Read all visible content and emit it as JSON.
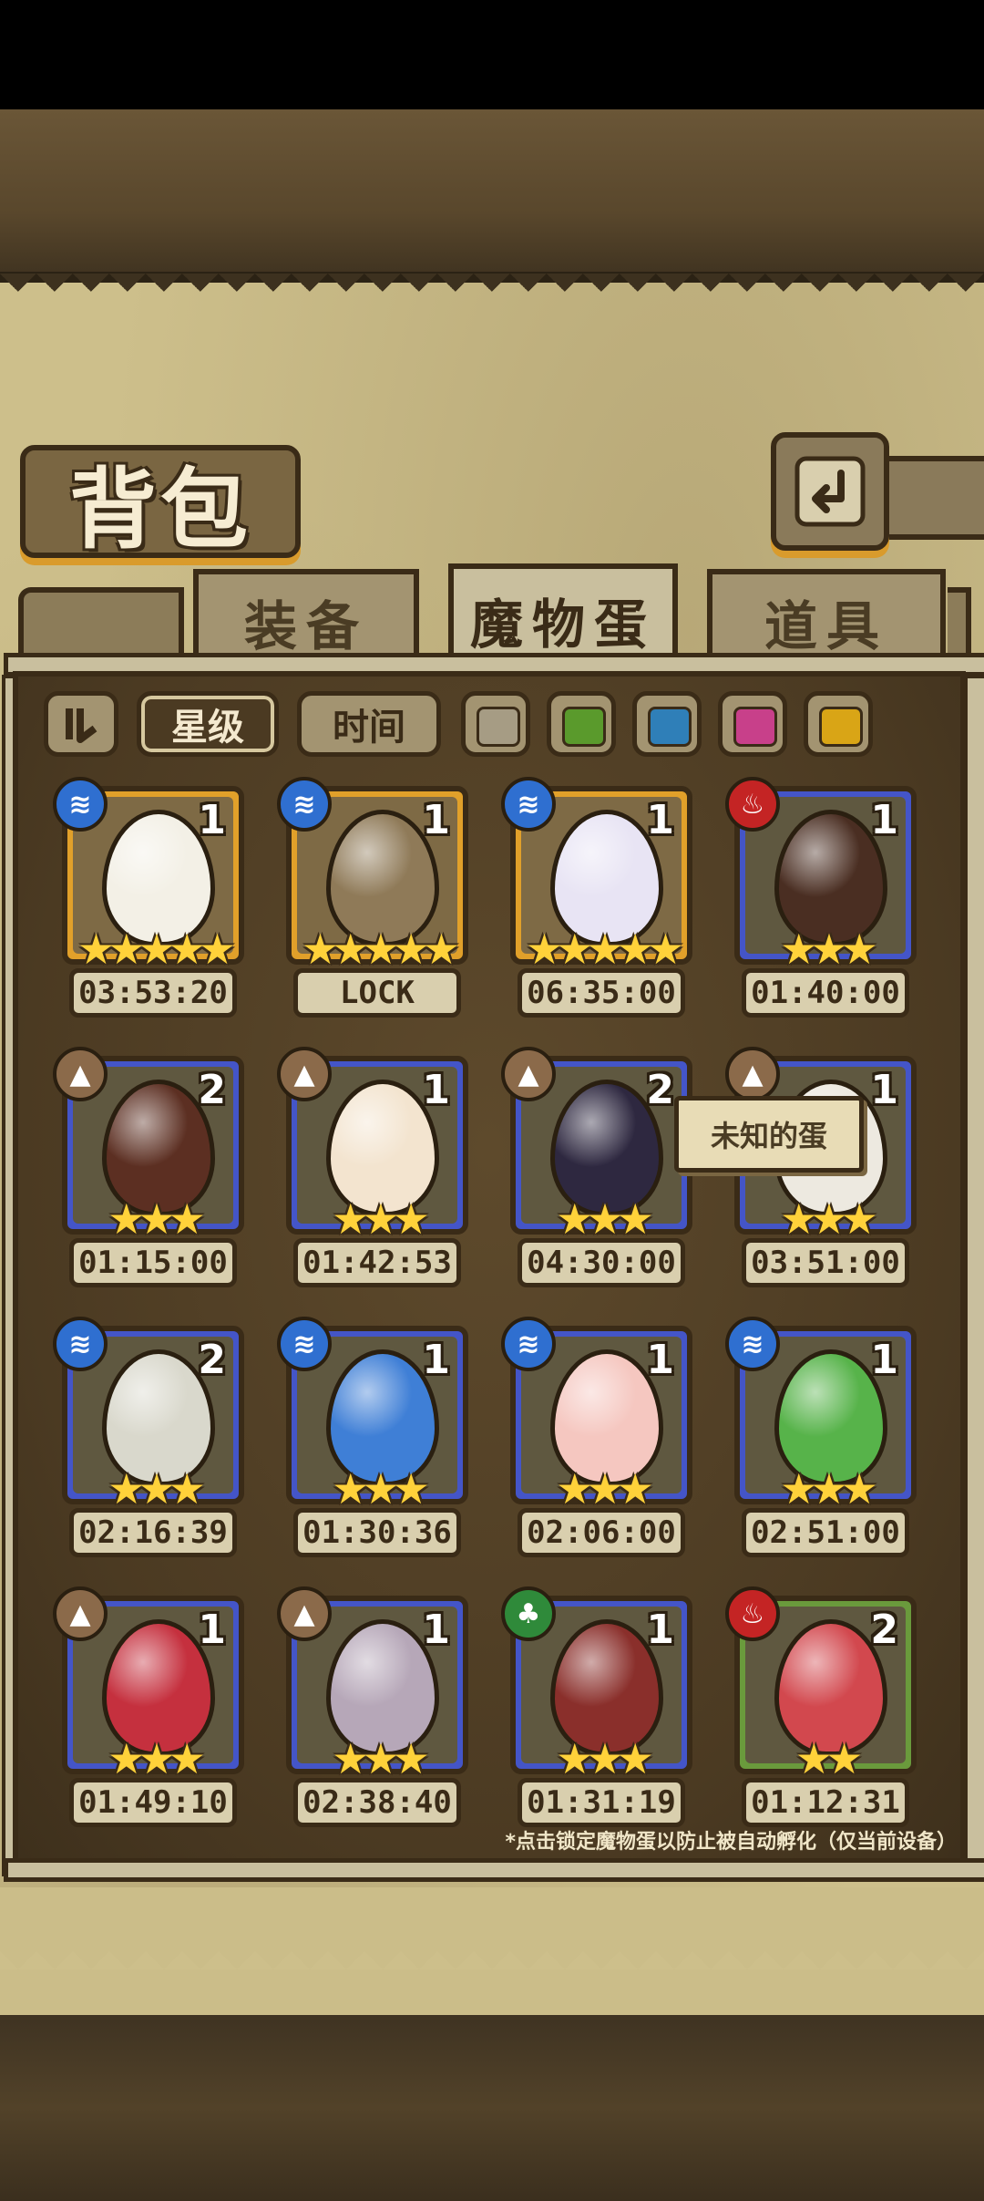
{
  "header": {
    "title": "背包",
    "back_icon": "back-arrow-icon"
  },
  "tabs": [
    {
      "label": "装备",
      "active": false
    },
    {
      "label": "魔物蛋",
      "active": true
    },
    {
      "label": "道具",
      "active": false
    }
  ],
  "filters": {
    "sort_icon": "sort-toggle-icon",
    "star_label": "星级",
    "time_label": "时间",
    "swatches": [
      {
        "name": "gray",
        "color": "#a69c84"
      },
      {
        "name": "green",
        "color": "#5a9a2c"
      },
      {
        "name": "blue",
        "color": "#2f7fb8"
      },
      {
        "name": "pink",
        "color": "#c8408a"
      },
      {
        "name": "yellow",
        "color": "#d9a516"
      }
    ]
  },
  "eggs": [
    {
      "element": "water",
      "count": "1",
      "stars": "★★★★★",
      "time": "03:53:20",
      "frame": "gold",
      "color": "#f3f0e6"
    },
    {
      "element": "water",
      "count": "1",
      "stars": "★★★★★",
      "time": "LOCK",
      "frame": "gold",
      "color": "#8f7a58"
    },
    {
      "element": "water",
      "count": "1",
      "stars": "★★★★★",
      "time": "06:35:00",
      "frame": "gold",
      "color": "#e8e4f4"
    },
    {
      "element": "fire",
      "count": "1",
      "stars": "★★★",
      "time": "01:40:00",
      "frame": "blue",
      "color": "#4a2e22"
    },
    {
      "element": "earth",
      "count": "2",
      "stars": "★★★",
      "time": "01:15:00",
      "frame": "blue",
      "color": "#5c2f22"
    },
    {
      "element": "earth",
      "count": "1",
      "stars": "★★★",
      "time": "01:42:53",
      "frame": "blue",
      "color": "#f3e4cf"
    },
    {
      "element": "earth",
      "count": "2",
      "stars": "★★★",
      "time": "04:30:00",
      "frame": "blue",
      "color": "#2e2840"
    },
    {
      "element": "earth",
      "count": "1",
      "stars": "★★★",
      "time": "03:51:00",
      "frame": "blue",
      "color": "#ede9e0"
    },
    {
      "element": "water",
      "count": "2",
      "stars": "★★★",
      "time": "02:16:39",
      "frame": "blue",
      "color": "#d9d8cc"
    },
    {
      "element": "water",
      "count": "1",
      "stars": "★★★",
      "time": "01:30:36",
      "frame": "blue",
      "color": "#3f7fd6"
    },
    {
      "element": "water",
      "count": "1",
      "stars": "★★★",
      "time": "02:06:00",
      "frame": "blue",
      "color": "#f5c7c0"
    },
    {
      "element": "water",
      "count": "1",
      "stars": "★★★",
      "time": "02:51:00",
      "frame": "blue",
      "color": "#57b34a"
    },
    {
      "element": "earth",
      "count": "1",
      "stars": "★★★",
      "time": "01:49:10",
      "frame": "blue",
      "color": "#c5303e"
    },
    {
      "element": "earth",
      "count": "1",
      "stars": "★★★",
      "time": "02:38:40",
      "frame": "blue",
      "color": "#b6a7b8"
    },
    {
      "element": "wood",
      "count": "1",
      "stars": "★★★",
      "time": "01:31:19",
      "frame": "blue",
      "color": "#8a2f2b"
    },
    {
      "element": "fire",
      "count": "2",
      "stars": "★★",
      "time": "01:12:31",
      "frame": "green",
      "color": "#d2484e"
    }
  ],
  "element_glyphs": {
    "water": "≋",
    "earth": "▲",
    "fire": "♨",
    "wood": "♣"
  },
  "tooltip": "未知的蛋",
  "footnote": "*点击锁定魔物蛋以防止被自动孵化（仅当前设备）"
}
